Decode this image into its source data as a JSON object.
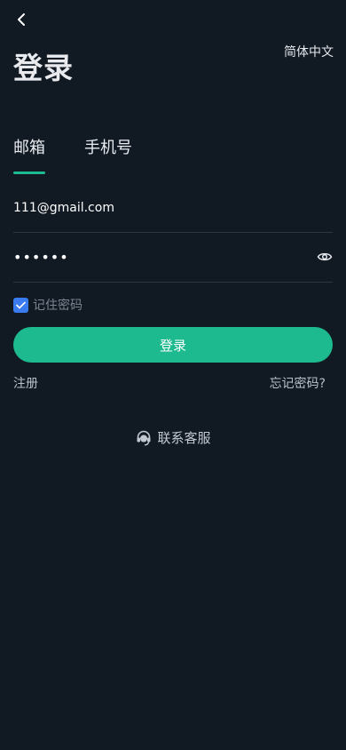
{
  "header": {
    "back_icon": "chevron-left-icon",
    "language_label": "简体中文",
    "title": "登录"
  },
  "tabs": [
    {
      "label": "邮箱",
      "active": true
    },
    {
      "label": "手机号",
      "active": false
    }
  ],
  "form": {
    "email_value": "111@gmail.com",
    "password_value": "••••••",
    "password_icon": "eye-icon",
    "remember_label": "记住密码",
    "remember_checked": true,
    "submit_label": "登录"
  },
  "links": {
    "register_label": "注册",
    "forgot_label": "忘记密码?"
  },
  "support": {
    "icon": "headset-icon",
    "label": "联系客服"
  },
  "colors": {
    "background": "#111923",
    "accent": "#1db98f",
    "checkbox": "#3a7bf0",
    "divider": "#2c3642"
  }
}
